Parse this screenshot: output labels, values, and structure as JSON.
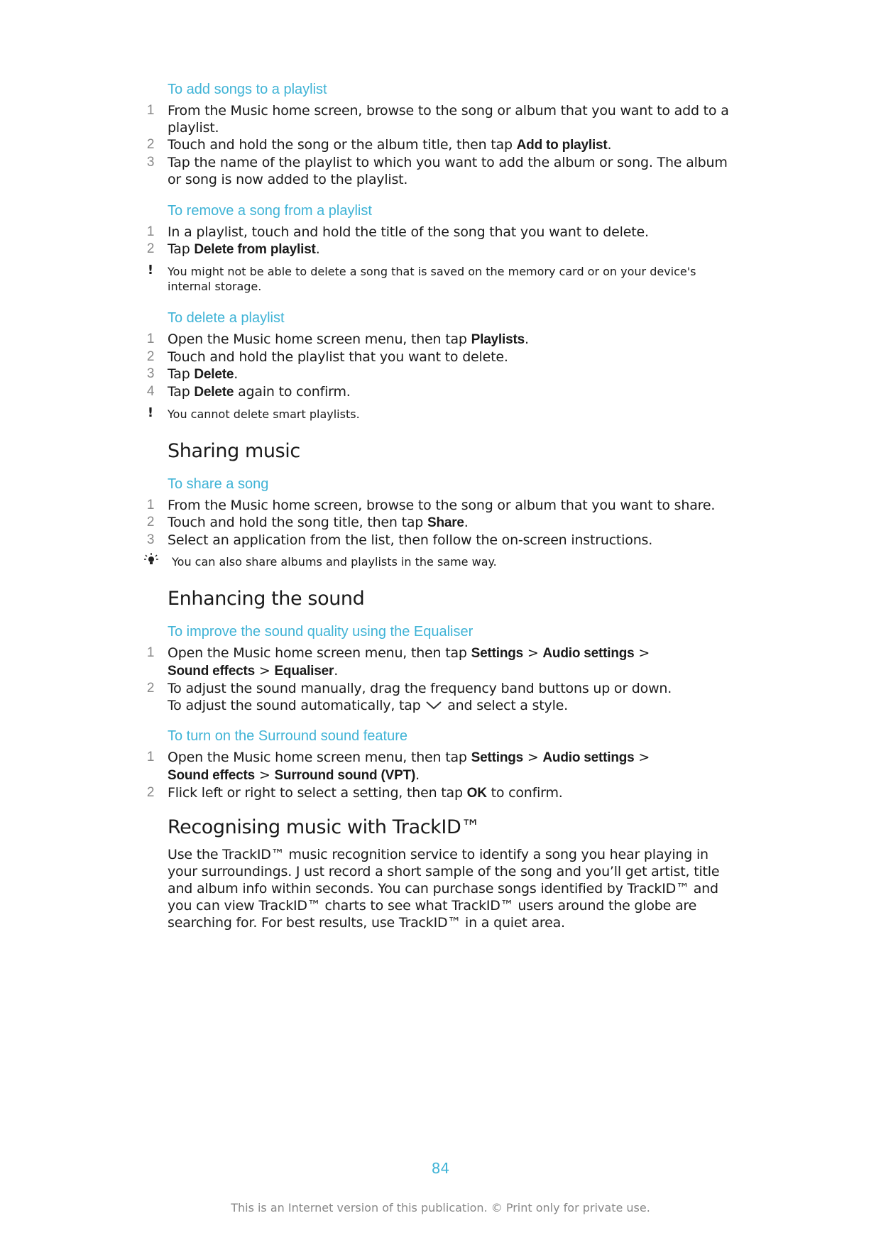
{
  "procedures": {
    "add_songs": {
      "title": "To add songs to a playlist",
      "steps": [
        {
          "num": "1",
          "text": "From the Music home screen, browse to the song or album that you want to add to a playlist."
        },
        {
          "num": "2",
          "pre": "Touch and hold the song or the album title, then tap ",
          "bold": "Add to playlist",
          "post": "."
        },
        {
          "num": "3",
          "text": "Tap the name of the playlist to which you want to add the album or song. The album or song is now added to the playlist."
        }
      ]
    },
    "remove_song": {
      "title": "To remove a song from a playlist",
      "steps": [
        {
          "num": "1",
          "text": "In a playlist, touch and hold the title of the song that you want to delete."
        },
        {
          "num": "2",
          "pre": "Tap ",
          "bold": "Delete from playlist",
          "post": "."
        }
      ],
      "note": "You might not be able to delete a song that is saved on the memory card or on your device's internal storage."
    },
    "delete_playlist": {
      "title": "To delete a playlist",
      "steps": [
        {
          "num": "1",
          "pre": "Open the Music home screen menu, then tap ",
          "bold": "Playlists",
          "post": "."
        },
        {
          "num": "2",
          "text": "Touch and hold the playlist that you want to delete."
        },
        {
          "num": "3",
          "pre": "Tap ",
          "bold": "Delete",
          "post": "."
        },
        {
          "num": "4",
          "pre": "Tap ",
          "bold": "Delete",
          "post": " again to confirm."
        }
      ],
      "note": "You cannot delete smart playlists."
    },
    "share_song": {
      "title": "To share a song",
      "steps": [
        {
          "num": "1",
          "text": "From the Music home screen, browse to the song or album that you want to share."
        },
        {
          "num": "2",
          "pre": "Touch and hold the song title, then tap ",
          "bold": "Share",
          "post": "."
        },
        {
          "num": "3",
          "text": "Select an application from the list, then follow the on-screen instructions."
        }
      ],
      "tip": "You can also share albums and playlists in the same way."
    },
    "equaliser": {
      "title": "To improve the sound quality using the Equaliser",
      "step1": {
        "num": "1",
        "a": "Open the Music home screen menu, then tap ",
        "b1": "Settings",
        "s1": " > ",
        "b2": "Audio settings",
        "s2": " > ",
        "b3": "Sound effects",
        "s3": " > ",
        "b4": "Equaliser",
        "end": "."
      },
      "step2": {
        "num": "2",
        "line1": "To adjust the sound manually, drag the frequency band buttons up or down.",
        "line2a": "To adjust the sound automatically, tap ",
        "icon": "chevron-down-icon",
        "line2b": " and select a style."
      }
    },
    "surround": {
      "title": "To turn on the Surround sound feature",
      "step1": {
        "num": "1",
        "a": "Open the Music home screen menu, then tap ",
        "b1": "Settings",
        "s1": " > ",
        "b2": "Audio settings",
        "s2": " > ",
        "b3": "Sound effects",
        "s3": " > ",
        "b4": "Surround sound (VPT)",
        "end": "."
      },
      "step2": {
        "num": "2",
        "pre": "Flick left or right to select a setting, then tap ",
        "bold": "OK",
        "post": " to confirm."
      }
    }
  },
  "sections": {
    "sharing": "Sharing music",
    "enhancing": "Enhancing the sound",
    "trackid": "Recognising music with TrackID™"
  },
  "trackid_body": "Use the TrackID™  music recognition service to identify a song you hear playing in your surroundings. J ust record a short sample of the song and you’ll get artist, title and album info within seconds. You can purchase songs identified by TrackID™  and you can view TrackID™  charts to see what TrackID™  users around the globe are searching for. For best results, use TrackID™  in a quiet area.",
  "icons": {
    "warning": "!",
    "tip": "lightbulb-icon"
  },
  "page_number": "84",
  "footer": "This is an Internet version of this publication. © Print only for private use.",
  "colors": {
    "heading_accent": "#3fb3d6",
    "step_number": "#888888"
  }
}
